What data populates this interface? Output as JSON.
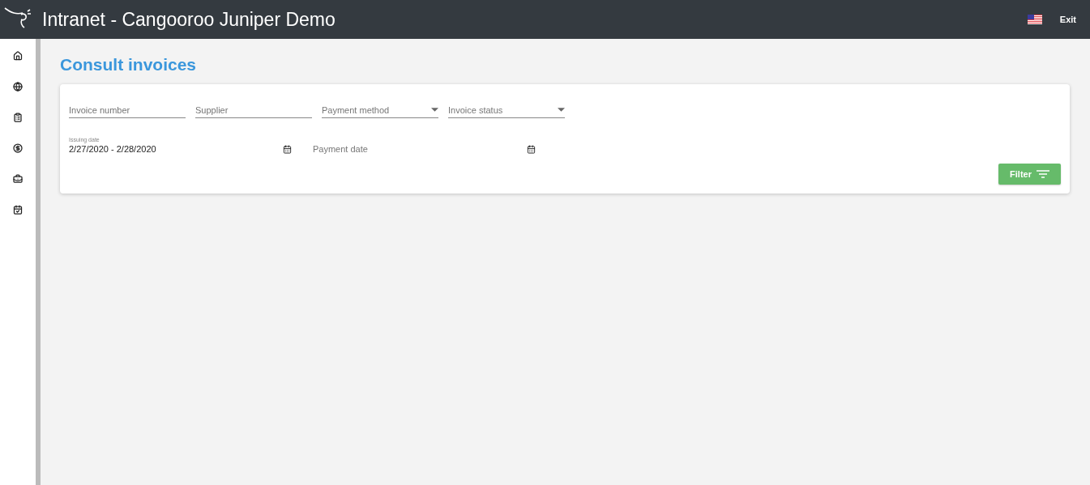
{
  "header": {
    "title": "Intranet - Cangooroo Juniper Demo",
    "exit": "Exit"
  },
  "sidebar": {
    "items": [
      {
        "kind": "home"
      },
      {
        "kind": "globe"
      },
      {
        "kind": "clipboard"
      },
      {
        "kind": "money"
      },
      {
        "kind": "case"
      },
      {
        "kind": "calendar"
      }
    ]
  },
  "page": {
    "title": "Consult invoices"
  },
  "filters": {
    "row_1": [
      {
        "kind": "text",
        "placeholder": "Invoice number"
      },
      {
        "kind": "text",
        "placeholder": "Supplier"
      },
      {
        "kind": "select",
        "placeholder": "Payment method"
      },
      {
        "kind": "select",
        "placeholder": "Invoice status"
      }
    ],
    "row_2": [
      {
        "kind": "date",
        "label": "Issuing date",
        "value": "2/27/2020 - 2/28/2020"
      },
      {
        "kind": "date",
        "placeholder": "Payment date"
      }
    ],
    "button": "Filter"
  }
}
